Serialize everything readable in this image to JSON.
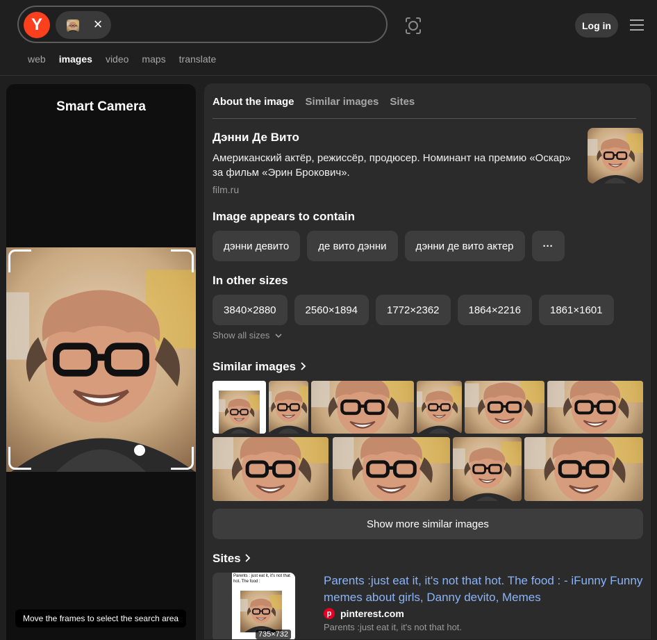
{
  "header": {
    "logo_letter": "Y",
    "close_glyph": "×",
    "login_label": "Log in",
    "icons": [
      "yandex-logo",
      "close-icon",
      "camera-icon",
      "hamburger-menu-icon"
    ],
    "accent_color": "#fc3f1d"
  },
  "nav": {
    "tabs": [
      "web",
      "images",
      "video",
      "maps",
      "translate"
    ],
    "active": "images"
  },
  "left_panel": {
    "title": "Smart Camera",
    "hint": "Move the frames to select the search area"
  },
  "right_panel": {
    "tabs": [
      "About the image",
      "Similar images",
      "Sites"
    ],
    "active_tab": "About the image",
    "entity": {
      "name": "Дэнни Де Вито",
      "description": "Американский актёр, режиссёр, продюсер. Номинант на премию «Оскар» за фильм «Эрин Брокович».",
      "source": "film.ru"
    },
    "contains": {
      "title": "Image appears to contain",
      "tags": [
        "дэнни девито",
        "де вито дэнни",
        "дэнни де вито актер"
      ],
      "more_glyph": "···"
    },
    "sizes": {
      "title": "In other sizes",
      "list": [
        "3840×2880",
        "2560×1894",
        "1772×2362",
        "1864×2216",
        "1861×1601"
      ],
      "show_all": "Show all sizes"
    },
    "similar": {
      "title": "Similar images",
      "more_button": "Show more similar images"
    },
    "sites": {
      "title": "Sites",
      "result": {
        "title": "Parents :just eat it, it's not that hot. The food : - iFunny Funny memes about girls, Danny devito, Memes",
        "domain": "pinterest.com",
        "snippet": "Parents :just eat it, it's not that hot.",
        "size": "735×732",
        "thumb_caption": "Parents : just eat it, it's not that hot. The food :"
      }
    }
  }
}
